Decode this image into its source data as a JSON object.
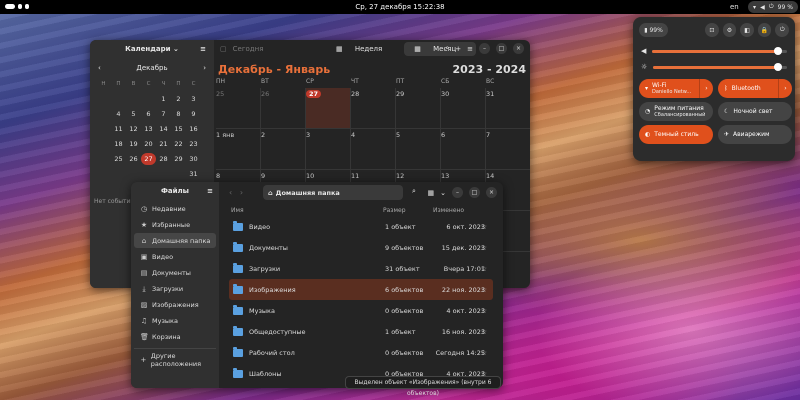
{
  "topbar": {
    "clock": "Ср, 27 декабря  15:22:38",
    "lang": "en",
    "battery": "99 %"
  },
  "calendar": {
    "sidebar_title": "Календари",
    "mini_month": "Декабрь",
    "weekdays_mini": [
      "Н",
      "П",
      "В",
      "С",
      "Ч",
      "П",
      "С"
    ],
    "mini_days": [
      [
        "",
        "",
        "",
        "",
        "1",
        "2",
        "3"
      ],
      [
        "",
        "4",
        "5",
        "6",
        "7",
        "8",
        "9"
      ],
      [
        "",
        "11",
        "12",
        "13",
        "14",
        "15",
        "16"
      ],
      [
        "",
        "18",
        "19",
        "20",
        "21",
        "22",
        "23"
      ],
      [
        "",
        "25",
        "26",
        "27",
        "28",
        "29",
        "30"
      ],
      [
        "",
        "",
        "",
        "",
        "",
        "",
        "31"
      ]
    ],
    "no_events": "Нет событий",
    "today_label": "Сегодня",
    "tab_week": "Неделя",
    "tab_month": "Месяц",
    "title": "Декабрь - Январь",
    "year": "2023 - 2024",
    "weekdays": [
      "ПН",
      "ВТ",
      "СР",
      "ЧТ",
      "ПТ",
      "СБ",
      "ВС"
    ],
    "rows": [
      [
        "25",
        "26",
        "27",
        "28",
        "29",
        "30",
        "31"
      ],
      [
        "1 янв",
        "2",
        "3",
        "4",
        "5",
        "6",
        "7"
      ],
      [
        "8",
        "9",
        "10",
        "11",
        "12",
        "13",
        "14"
      ],
      [
        "",
        "",
        "",
        "",
        "",
        "",
        ""
      ],
      [
        "",
        "",
        "",
        "",
        "",
        "",
        ""
      ]
    ]
  },
  "files": {
    "sidebar_title": "Файлы",
    "side_items": [
      "Недавние",
      "Избранные",
      "Домашняя папка",
      "Видео",
      "Документы",
      "Загрузки",
      "Изображения",
      "Музыка",
      "Корзина"
    ],
    "other_locations": "Другие расположения",
    "path": "Домашняя папка",
    "col_name": "Имя",
    "col_size": "Размер",
    "col_modified": "Изменено",
    "rows": [
      {
        "name": "Видео",
        "size": "1 объект",
        "mod": "6 окт. 2023"
      },
      {
        "name": "Документы",
        "size": "9 объектов",
        "mod": "15 дек. 2023"
      },
      {
        "name": "Загрузки",
        "size": "31 объект",
        "mod": "Вчера 17:01"
      },
      {
        "name": "Изображения",
        "size": "6 объектов",
        "mod": "22 ноя. 2023"
      },
      {
        "name": "Музыка",
        "size": "0 объектов",
        "mod": "4 окт. 2023"
      },
      {
        "name": "Общедоступные",
        "size": "1 объект",
        "mod": "16 ноя. 2023"
      },
      {
        "name": "Рабочий стол",
        "size": "0 объектов",
        "mod": "Сегодня 14:25"
      },
      {
        "name": "Шаблоны",
        "size": "0 объектов",
        "mod": "4 окт. 2023"
      }
    ],
    "status": "Выделен объект «Изображения» (внутри 6 объектов)"
  },
  "quick_settings": {
    "battery": "99%",
    "volume_level": 0.93,
    "brightness_level": 0.93,
    "wifi_title": "Wi-Fi",
    "wifi_sub": "Daniello Netw...",
    "bluetooth": "Bluetooth",
    "power_title": "Режим питания",
    "power_sub": "Сбалансированный",
    "night_light": "Ночной свет",
    "dark_style": "Темный стиль",
    "airplane": "Авиарежим"
  }
}
